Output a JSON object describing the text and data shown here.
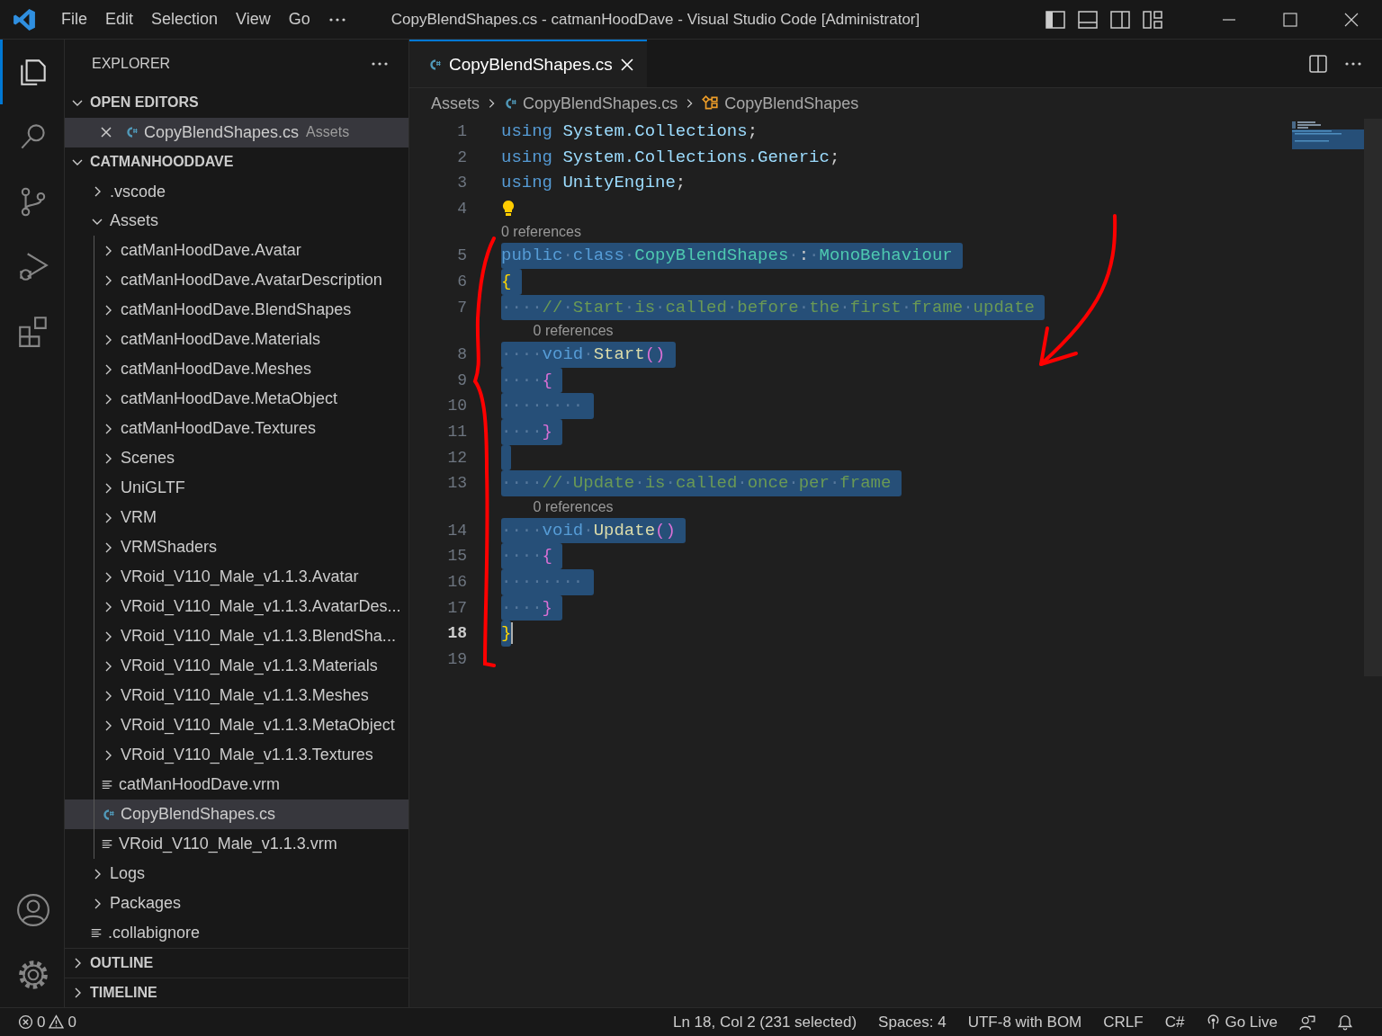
{
  "title_bar": {
    "menu": [
      "File",
      "Edit",
      "Selection",
      "View",
      "Go"
    ],
    "title": "CopyBlendShapes.cs - catmanHoodDave - Visual Studio Code [Administrator]"
  },
  "activity_bar": [
    {
      "kind": "explorer",
      "selected": true
    },
    {
      "kind": "search",
      "selected": false
    },
    {
      "kind": "source_control",
      "selected": false
    },
    {
      "kind": "run_debug",
      "selected": false
    },
    {
      "kind": "extensions",
      "selected": false
    }
  ],
  "sidebar": {
    "title": "EXPLORER",
    "sections": [
      {
        "label": "OPEN EDITORS",
        "kind": "open_editors",
        "expanded": true,
        "items": [
          {
            "name": "CopyBlendShapes.cs",
            "detail": "Assets",
            "selected": true
          }
        ]
      },
      {
        "label": "CATMANHOODDAVE",
        "kind": "folder",
        "expanded": true,
        "tree": [
          {
            "label": ".vscode",
            "kind": "folder",
            "expanded": false,
            "selected": false
          },
          {
            "label": "Assets",
            "kind": "folder",
            "expanded": true,
            "selected": false,
            "children": [
              {
                "label": "catManHoodDave.Avatar",
                "kind": "folder",
                "expanded": false,
                "selected": false
              },
              {
                "label": "catManHoodDave.AvatarDescription",
                "kind": "folder",
                "expanded": false,
                "selected": false
              },
              {
                "label": "catManHoodDave.BlendShapes",
                "kind": "folder",
                "expanded": false,
                "selected": false
              },
              {
                "label": "catManHoodDave.Materials",
                "kind": "folder",
                "expanded": false,
                "selected": false
              },
              {
                "label": "catManHoodDave.Meshes",
                "kind": "folder",
                "expanded": false,
                "selected": false
              },
              {
                "label": "catManHoodDave.MetaObject",
                "kind": "folder",
                "expanded": false,
                "selected": false
              },
              {
                "label": "catManHoodDave.Textures",
                "kind": "folder",
                "expanded": false,
                "selected": false
              },
              {
                "label": "Scenes",
                "kind": "folder",
                "expanded": false,
                "selected": false
              },
              {
                "label": "UniGLTF",
                "kind": "folder",
                "expanded": false,
                "selected": false
              },
              {
                "label": "VRM",
                "kind": "folder",
                "expanded": false,
                "selected": false
              },
              {
                "label": "VRMShaders",
                "kind": "folder",
                "expanded": false,
                "selected": false
              },
              {
                "label": "VRoid_V110_Male_v1.1.3.Avatar",
                "kind": "folder",
                "expanded": false,
                "selected": false
              },
              {
                "label": "VRoid_V110_Male_v1.1.3.AvatarDes...",
                "kind": "folder",
                "expanded": false,
                "selected": false
              },
              {
                "label": "VRoid_V110_Male_v1.1.3.BlendSha...",
                "kind": "folder",
                "expanded": false,
                "selected": false
              },
              {
                "label": "VRoid_V110_Male_v1.1.3.Materials",
                "kind": "folder",
                "expanded": false,
                "selected": false
              },
              {
                "label": "VRoid_V110_Male_v1.1.3.Meshes",
                "kind": "folder",
                "expanded": false,
                "selected": false
              },
              {
                "label": "VRoid_V110_Male_v1.1.3.MetaObject",
                "kind": "folder",
                "expanded": false,
                "selected": false
              },
              {
                "label": "VRoid_V110_Male_v1.1.3.Textures",
                "kind": "folder",
                "expanded": false,
                "selected": false
              },
              {
                "label": "catManHoodDave.vrm",
                "kind": "file",
                "selected": false
              },
              {
                "label": "CopyBlendShapes.cs",
                "kind": "csharp",
                "selected": true
              },
              {
                "label": "VRoid_V110_Male_v1.1.3.vrm",
                "kind": "file",
                "selected": false
              }
            ]
          },
          {
            "label": "Logs",
            "kind": "folder",
            "expanded": false,
            "selected": false
          },
          {
            "label": "Packages",
            "kind": "folder",
            "expanded": false,
            "selected": false
          },
          {
            "label": ".collabignore",
            "kind": "file",
            "selected": false
          }
        ]
      },
      {
        "label": "OUTLINE",
        "kind": "panel",
        "expanded": false
      },
      {
        "label": "TIMELINE",
        "kind": "panel",
        "expanded": false
      }
    ]
  },
  "editor": {
    "tabs": [
      {
        "label": "CopyBlendShapes.cs",
        "selected": true
      }
    ],
    "breadcrumbs": [
      {
        "text": "Assets",
        "kind": "folder"
      },
      {
        "text": "CopyBlendShapes.cs",
        "kind": "csharp"
      },
      {
        "text": "CopyBlendShapes",
        "kind": "class"
      }
    ],
    "lines": [
      {
        "number": "1",
        "selected": false,
        "tokens": [
          {
            "kind": "keyword",
            "text": "using "
          },
          {
            "kind": "namespace",
            "text": "System.Collections"
          },
          {
            "kind": "plain",
            "text": ";"
          }
        ]
      },
      {
        "number": "2",
        "selected": false,
        "tokens": [
          {
            "kind": "keyword",
            "text": "using "
          },
          {
            "kind": "namespace",
            "text": "System.Collections.Generic"
          },
          {
            "kind": "plain",
            "text": ";"
          }
        ]
      },
      {
        "number": "3",
        "selected": false,
        "tokens": [
          {
            "kind": "keyword",
            "text": "using "
          },
          {
            "kind": "namespace",
            "text": "UnityEngine"
          },
          {
            "kind": "plain",
            "text": ";"
          }
        ]
      },
      {
        "number": "4",
        "selected": false,
        "lightbulb": true
      },
      {
        "number": "5",
        "selected": true,
        "codelens": "0 references",
        "tokens": [
          {
            "kind": "keyword",
            "text": "public·class·"
          },
          {
            "kind": "type",
            "text": "CopyBlendShapes"
          },
          {
            "kind": "plain",
            "text": "·:·"
          },
          {
            "kind": "type",
            "text": "MonoBehaviour"
          }
        ]
      },
      {
        "number": "6",
        "selected": true,
        "tokens": [
          {
            "kind": "bracket1",
            "text": "{"
          }
        ]
      },
      {
        "number": "7",
        "selected": true,
        "tokens": [
          {
            "kind": "comment",
            "text": "····//·Start·is·called·before·the·first·frame·update"
          }
        ]
      },
      {
        "number": "8",
        "selected": true,
        "codelens": "0 references",
        "tokens": [
          {
            "kind": "keyword",
            "text": "····void·"
          },
          {
            "kind": "function",
            "text": "Start"
          },
          {
            "kind": "bracket2",
            "text": "()"
          }
        ]
      },
      {
        "number": "9",
        "selected": true,
        "tokens": [
          {
            "kind": "bracket2",
            "text": "····{"
          }
        ]
      },
      {
        "number": "10",
        "selected": true,
        "tokens": [
          {
            "kind": "plain",
            "text": "········"
          }
        ]
      },
      {
        "number": "11",
        "selected": true,
        "tokens": [
          {
            "kind": "bracket2",
            "text": "····}"
          }
        ]
      },
      {
        "number": "12",
        "selected": true
      },
      {
        "number": "13",
        "selected": true,
        "tokens": [
          {
            "kind": "comment",
            "text": "····//·Update·is·called·once·per·frame"
          }
        ]
      },
      {
        "number": "14",
        "selected": true,
        "codelens": "0 references",
        "tokens": [
          {
            "kind": "keyword",
            "text": "····void·"
          },
          {
            "kind": "function",
            "text": "Update"
          },
          {
            "kind": "bracket2",
            "text": "()"
          }
        ]
      },
      {
        "number": "15",
        "selected": true,
        "tokens": [
          {
            "kind": "bracket2",
            "text": "····{"
          }
        ]
      },
      {
        "number": "16",
        "selected": true,
        "tokens": [
          {
            "kind": "plain",
            "text": "········"
          }
        ]
      },
      {
        "number": "17",
        "selected": true,
        "tokens": [
          {
            "kind": "bracket2",
            "text": "····}"
          }
        ]
      },
      {
        "number": "18",
        "selected": true,
        "current": true,
        "tokens": [
          {
            "kind": "bracket1",
            "text": "}"
          }
        ]
      },
      {
        "number": "19",
        "selected": false
      }
    ]
  },
  "status_bar": {
    "errors": "0",
    "warnings": "0",
    "items": [
      {
        "kind": "text",
        "text": "Ln 18, Col 2 (231 selected)"
      },
      {
        "kind": "text",
        "text": "Spaces: 4"
      },
      {
        "kind": "text",
        "text": "UTF-8 with BOM"
      },
      {
        "kind": "text",
        "text": "CRLF"
      },
      {
        "kind": "text",
        "text": "C#"
      },
      {
        "kind": "live",
        "text": "Go Live"
      }
    ]
  }
}
